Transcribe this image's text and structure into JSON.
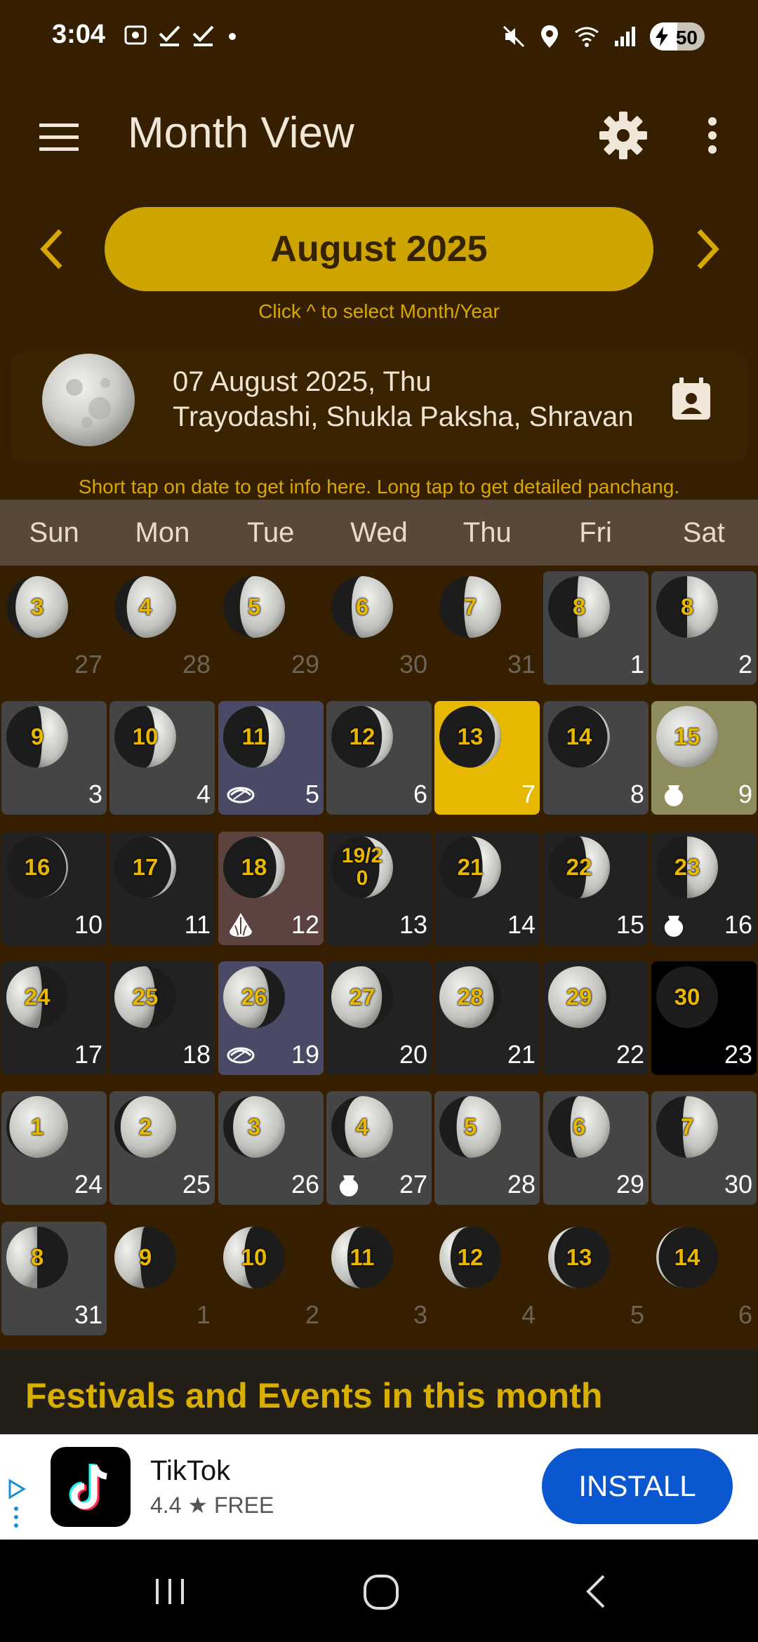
{
  "status": {
    "time": "3:04",
    "battery": "50",
    "battery_level": 0.5
  },
  "app": {
    "title": "Month View"
  },
  "month": {
    "label": "August 2025",
    "hint": "Click ^ to select Month/Year"
  },
  "selected": {
    "line1": "07 August 2025, Thu",
    "line2": "Trayodashi, Shukla Paksha, Shravan",
    "hint": "Short tap on date to get info here. Long tap to get detailed panchang."
  },
  "weekdays": [
    "Sun",
    "Mon",
    "Tue",
    "Wed",
    "Thu",
    "Fri",
    "Sat"
  ],
  "weeks": [
    [
      {
        "tithi": "3",
        "date": "27",
        "phase": 0.15,
        "style": "other"
      },
      {
        "tithi": "4",
        "date": "28",
        "phase": 0.2,
        "style": "other"
      },
      {
        "tithi": "5",
        "date": "29",
        "phase": 0.27,
        "style": "other"
      },
      {
        "tithi": "6",
        "date": "30",
        "phase": 0.33,
        "style": "other"
      },
      {
        "tithi": "7",
        "date": "31",
        "phase": 0.4,
        "style": "other"
      },
      {
        "tithi": "8",
        "date": "1",
        "phase": 0.47,
        "style": "gray"
      },
      {
        "tithi": "8",
        "date": "2",
        "phase": 0.5,
        "style": "gray"
      }
    ],
    [
      {
        "tithi": "9",
        "date": "3",
        "phase": 0.58,
        "style": "gray"
      },
      {
        "tithi": "10",
        "date": "4",
        "phase": 0.66,
        "style": "gray"
      },
      {
        "tithi": "11",
        "date": "5",
        "phase": 0.74,
        "style": "purple",
        "event": "sweet"
      },
      {
        "tithi": "12",
        "date": "6",
        "phase": 0.82,
        "style": "gray"
      },
      {
        "tithi": "13",
        "date": "7",
        "phase": 0.9,
        "style": "yellow"
      },
      {
        "tithi": "14",
        "date": "8",
        "phase": 0.96,
        "style": "gray"
      },
      {
        "tithi": "15",
        "date": "9",
        "phase": 1.0,
        "style": "olive",
        "event": "pot"
      }
    ],
    [
      {
        "tithi": "16",
        "date": "10",
        "phase": 0.97,
        "style": "dark"
      },
      {
        "tithi": "17",
        "date": "11",
        "phase": 0.92,
        "style": "dark"
      },
      {
        "tithi": "18",
        "date": "12",
        "phase": 0.86,
        "style": "brown",
        "event": "modak"
      },
      {
        "tithi": "19/20",
        "date": "13",
        "phase": 0.78,
        "style": "dark"
      },
      {
        "tithi": "21",
        "date": "14",
        "phase": 0.7,
        "style": "dark"
      },
      {
        "tithi": "22",
        "date": "15",
        "phase": 0.62,
        "style": "dark"
      },
      {
        "tithi": "23",
        "date": "16",
        "phase": 0.5,
        "style": "dark",
        "event": "pot"
      }
    ],
    [
      {
        "tithi": "24",
        "date": "17",
        "phase": 0.42,
        "style": "dark"
      },
      {
        "tithi": "25",
        "date": "18",
        "phase": 0.34,
        "style": "dark"
      },
      {
        "tithi": "26",
        "date": "19",
        "phase": 0.26,
        "style": "purple",
        "event": "sweet"
      },
      {
        "tithi": "27",
        "date": "20",
        "phase": 0.18,
        "style": "dark"
      },
      {
        "tithi": "28",
        "date": "21",
        "phase": 0.12,
        "style": "dark"
      },
      {
        "tithi": "29",
        "date": "22",
        "phase": 0.06,
        "style": "dark"
      },
      {
        "tithi": "30",
        "date": "23",
        "phase": 0.0,
        "style": "black"
      }
    ],
    [
      {
        "tithi": "1",
        "date": "24",
        "phase": 0.05,
        "style": "gray"
      },
      {
        "tithi": "2",
        "date": "25",
        "phase": 0.1,
        "style": "gray"
      },
      {
        "tithi": "3",
        "date": "26",
        "phase": 0.16,
        "style": "gray"
      },
      {
        "tithi": "4",
        "date": "27",
        "phase": 0.22,
        "style": "gray",
        "event": "pot"
      },
      {
        "tithi": "5",
        "date": "28",
        "phase": 0.28,
        "style": "gray"
      },
      {
        "tithi": "6",
        "date": "29",
        "phase": 0.36,
        "style": "gray"
      },
      {
        "tithi": "7",
        "date": "30",
        "phase": 0.43,
        "style": "gray"
      }
    ],
    [
      {
        "tithi": "8",
        "date": "31",
        "phase": 0.5,
        "style": "gray"
      },
      {
        "tithi": "9",
        "date": "1",
        "phase": 0.58,
        "style": "other"
      },
      {
        "tithi": "10",
        "date": "2",
        "phase": 0.66,
        "style": "other"
      },
      {
        "tithi": "11",
        "date": "3",
        "phase": 0.74,
        "style": "other"
      },
      {
        "tithi": "12",
        "date": "4",
        "phase": 0.82,
        "style": "other"
      },
      {
        "tithi": "13",
        "date": "5",
        "phase": 0.9,
        "style": "other"
      },
      {
        "tithi": "14",
        "date": "6",
        "phase": 0.96,
        "style": "other"
      }
    ]
  ],
  "cell_colors": {
    "other": "transparent",
    "gray": "#454545",
    "dark": "#222222",
    "purple": "#4a4a66",
    "yellow": "#e6b800",
    "olive": "#8e8c5c",
    "brown": "#5c4340",
    "black": "#000000"
  },
  "festivals": {
    "title": "Festivals and Events in this month"
  },
  "ad": {
    "name": "TikTok",
    "rating": "4.4 ★  FREE",
    "install": "INSTALL"
  },
  "icons": {
    "menu": "menu-icon",
    "settings": "gear-icon",
    "more": "more-vert-icon",
    "prev": "chevron-left-icon",
    "next": "chevron-right-icon",
    "calendar": "calendar-icon"
  }
}
